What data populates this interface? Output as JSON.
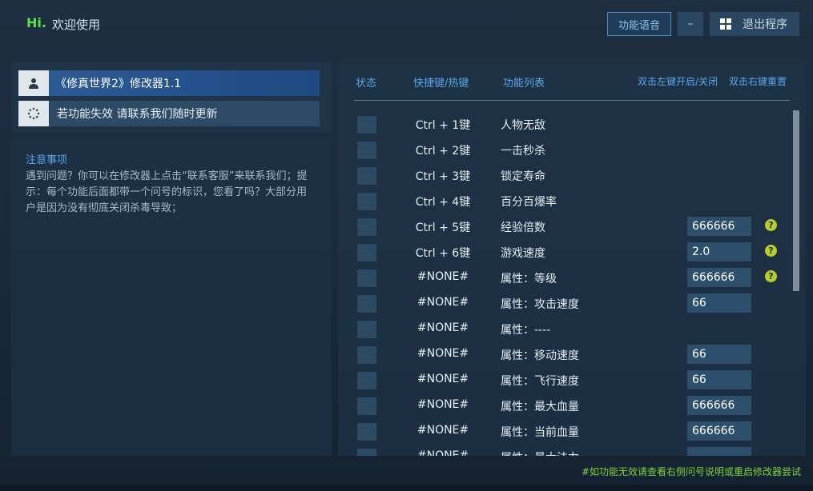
{
  "header": {
    "hi": "Hi.",
    "welcome": "欢迎使用",
    "voice_button": "功能语音",
    "minimize_label": "–",
    "exit_button": "退出程序"
  },
  "left": {
    "title": "《修真世界2》修改器1.1",
    "notice": "若功能失效  请联系我们随时更新",
    "notes_title": "注意事项",
    "notes_body": "遇到问题？你可以在修改器上点击“联系客服”来联系我们；提示：每个功能后面都带一个问号的标识，您看了吗？大部分用户是因为没有彻底关闭杀毒导致；"
  },
  "table": {
    "col_status": "状态",
    "col_hotkey": "快捷键/热键",
    "col_features": "功能列表",
    "hint_left_click": "双击左键开启/关闭",
    "hint_right_click": "双击右键重置",
    "rows": [
      {
        "key": "Ctrl + 1键",
        "label": "人物无敌",
        "value": null,
        "help": false
      },
      {
        "key": "Ctrl + 2键",
        "label": "一击秒杀",
        "value": null,
        "help": false
      },
      {
        "key": "Ctrl + 3键",
        "label": "锁定寿命",
        "value": null,
        "help": false
      },
      {
        "key": "Ctrl + 4键",
        "label": "百分百爆率",
        "value": null,
        "help": false
      },
      {
        "key": "Ctrl + 5键",
        "label": "经验倍数",
        "value": "666666",
        "help": true
      },
      {
        "key": "Ctrl + 6键",
        "label": "游戏速度",
        "value": "2.0",
        "help": true
      },
      {
        "key": "#NONE#",
        "label": "属性：等级",
        "value": "666666",
        "help": true
      },
      {
        "key": "#NONE#",
        "label": "属性：攻击速度",
        "value": "66",
        "help": false
      },
      {
        "key": "#NONE#",
        "label": "属性：----",
        "value": null,
        "help": false
      },
      {
        "key": "#NONE#",
        "label": "属性：移动速度",
        "value": "66",
        "help": false
      },
      {
        "key": "#NONE#",
        "label": "属性：飞行速度",
        "value": "66",
        "help": false
      },
      {
        "key": "#NONE#",
        "label": "属性：最大血量",
        "value": "666666",
        "help": false
      },
      {
        "key": "#NONE#",
        "label": "属性：当前血量",
        "value": "666666",
        "help": false
      },
      {
        "key": "#NONE#",
        "label": "属性：最大法力",
        "value": "",
        "help": false
      }
    ],
    "help_glyph": "?"
  },
  "footer": {
    "note": "#如功能无效请查看右侧问号说明或重启修改器尝试"
  },
  "colors": {
    "accent_green": "#5ee04a",
    "accent_blue": "#5ba7e6",
    "help_yellow": "#b8cc2a"
  }
}
